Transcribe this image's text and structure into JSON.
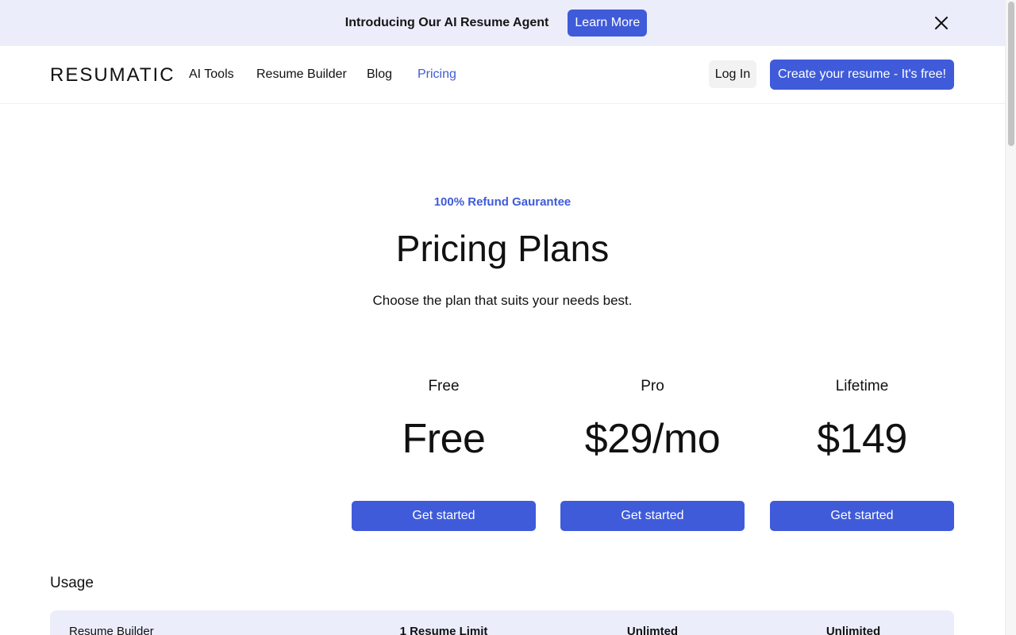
{
  "banner": {
    "text": "Introducing Our AI Resume Agent",
    "button_label": "Learn More",
    "close_icon": "close-icon"
  },
  "nav": {
    "logo": "RESUMATIC",
    "links": [
      {
        "label": "AI Tools",
        "active": false
      },
      {
        "label": "Resume Builder",
        "active": false
      },
      {
        "label": "Blog",
        "active": false
      },
      {
        "label": "Pricing",
        "active": true
      }
    ],
    "login_label": "Log In",
    "cta_label": "Create your resume - It's free!"
  },
  "hero": {
    "eyebrow": "100% Refund Gaurantee",
    "title": "Pricing Plans",
    "subtitle": "Choose the plan that suits your needs best."
  },
  "plans": [
    {
      "name": "Free",
      "price": "Free",
      "button_label": "Get started"
    },
    {
      "name": "Pro",
      "price": "$29/mo",
      "button_label": "Get started"
    },
    {
      "name": "Lifetime",
      "price": "$149",
      "button_label": "Get started"
    }
  ],
  "usage": {
    "heading": "Usage",
    "rows": [
      {
        "feature": "Resume Builder",
        "free": "1 Resume Limit",
        "pro": "Unlimted",
        "lifetime": "Unlimited"
      }
    ]
  },
  "colors": {
    "accent": "#3f5bd9",
    "banner_bg": "#ebedfa",
    "text": "#111111"
  }
}
